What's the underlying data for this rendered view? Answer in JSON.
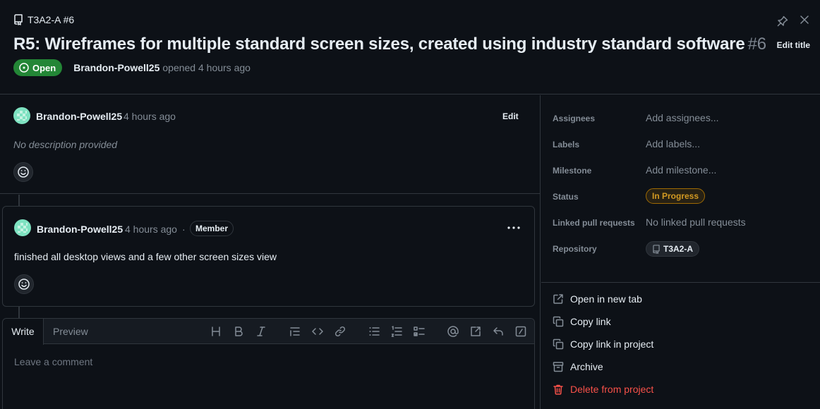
{
  "header": {
    "breadcrumb": "T3A2-A #6",
    "title": "R5: Wireframes for multiple standard screen sizes, created using industry standard software",
    "number": "#6",
    "edit_title_label": "Edit title",
    "status_badge": "Open",
    "author": "Brandon-Powell25",
    "opened_text": "opened 4 hours ago"
  },
  "description": {
    "author": "Brandon-Powell25",
    "time": "4 hours ago",
    "edit_label": "Edit",
    "body": "No description provided"
  },
  "comment": {
    "author": "Brandon-Powell25",
    "time": "4 hours ago",
    "separator": "·",
    "role_badge": "Member",
    "body": "finished all desktop views and a few other screen sizes view"
  },
  "editor": {
    "tabs": [
      "Write",
      "Preview"
    ],
    "placeholder": "Leave a comment",
    "toolbar_icons": [
      "heading-icon",
      "bold-icon",
      "italic-icon",
      "quote-icon",
      "code-icon",
      "link-icon",
      "bullet-list-icon",
      "numbered-list-icon",
      "task-list-icon",
      "mention-icon",
      "reference-icon",
      "reply-icon",
      "slash-command-icon"
    ]
  },
  "sidebar": {
    "fields": [
      {
        "label": "Assignees",
        "value": "Add assignees..."
      },
      {
        "label": "Labels",
        "value": "Add labels..."
      },
      {
        "label": "Milestone",
        "value": "Add milestone..."
      },
      {
        "label": "Status",
        "value": "In Progress"
      },
      {
        "label": "Linked pull requests",
        "value": "No linked pull requests"
      },
      {
        "label": "Repository",
        "value": "T3A2-A"
      }
    ],
    "actions": [
      {
        "label": "Open in new tab",
        "icon": "external-link-icon"
      },
      {
        "label": "Copy link",
        "icon": "copy-icon"
      },
      {
        "label": "Copy link in project",
        "icon": "copy-icon"
      },
      {
        "label": "Archive",
        "icon": "archive-icon"
      },
      {
        "label": "Delete from project",
        "icon": "trash-icon"
      }
    ]
  },
  "colors": {
    "background": "#0d1117",
    "open_green": "#238636",
    "status_amber": "#d29922",
    "danger": "#f85149",
    "muted": "#848d97"
  }
}
